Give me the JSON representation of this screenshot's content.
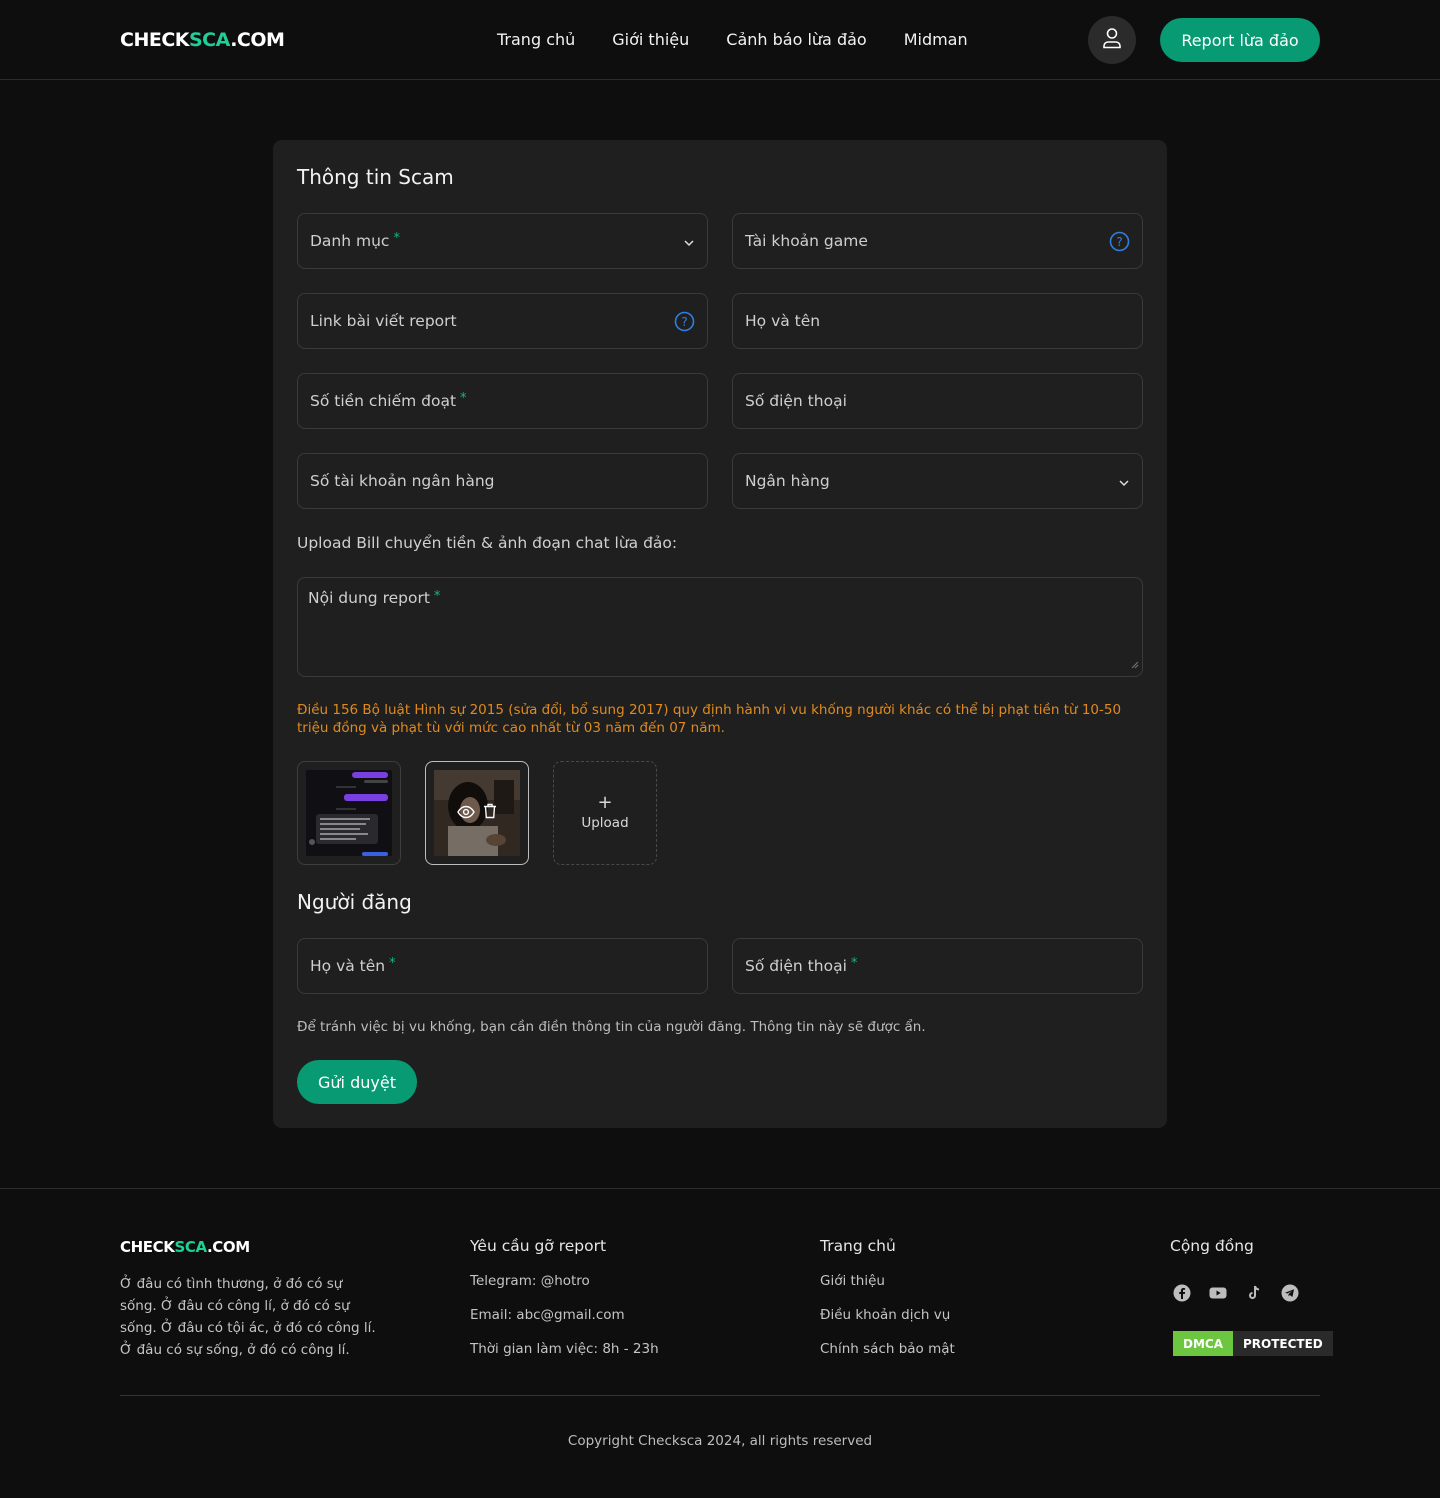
{
  "header": {
    "logo_main": "CHECK",
    "logo_accent": "SCA",
    "logo_tail": ".COM",
    "nav": [
      "Trang chủ",
      "Giới thiệu",
      "Cảnh báo lừa đảo",
      "Midman"
    ],
    "report_button": "Report lừa đảo",
    "user_icon": "user-icon"
  },
  "form": {
    "scam_section_title": "Thông tin Scam",
    "category": "Danh mục",
    "game_account": "Tài khoản game",
    "report_link": "Link bài viết report",
    "full_name": "Họ và tên",
    "amount": "Số tiền chiếm đoạt",
    "phone": "Số điện thoại",
    "bank_account": "Số tài khoản ngân hàng",
    "bank": "Ngân hàng",
    "upload_caption": "Upload Bill chuyển tiền & ảnh đoạn chat lừa đảo:",
    "content": "Nội dung report",
    "required_mark": "*",
    "warning": "Điều 156 Bộ luật Hình sự 2015 (sửa đổi, bổ sung 2017) quy định hành vi vu khống người khác có thể bị phạt tiền từ 10-50 triệu đồng và phạt tù với mức cao nhất từ 03 năm đến 07 năm.",
    "upload_plus": "+",
    "upload_label": "Upload",
    "poster_section_title": "Người đăng",
    "poster_name": "Họ và tên",
    "poster_phone": "Số điện thoại",
    "poster_note": "Để tránh việc bị vu khống, bạn cần điền thông tin của người đăng. Thông tin này sẽ được ẩn.",
    "submit": "Gửi duyệt"
  },
  "footer": {
    "logo_main": "CHECK",
    "logo_accent": "SCA",
    "logo_tail": ".COM",
    "about": "Ở đâu có tình thương, ở đó có sự sống. Ở đâu có công lí, ở đó có sự sống. Ở đâu có tội ác, ở đó có công lí. Ở đâu có sự sống, ở đó có công lí.",
    "col2_title": "Yêu cầu gỡ report",
    "col2_items": [
      "Telegram: @hotro",
      "Email: abc@gmail.com",
      "Thời gian làm việc: 8h - 23h"
    ],
    "col3_title": "Trang chủ",
    "col3_items": [
      "Giới thiệu",
      "Điều khoản dịch vụ",
      "Chính sách bảo mật"
    ],
    "col4_title": "Cộng đồng",
    "social": [
      "facebook-icon",
      "youtube-icon",
      "tiktok-icon",
      "telegram-icon"
    ],
    "dmca_left": "DMCA",
    "dmca_right": "PROTECTED",
    "copyright": "Copyright Checksca 2024, all rights reserved"
  },
  "colors": {
    "accent": "#079a73",
    "logo_accent": "#1fcf96",
    "warning": "#e08a1e",
    "help_icon": "#2f7fe0"
  }
}
